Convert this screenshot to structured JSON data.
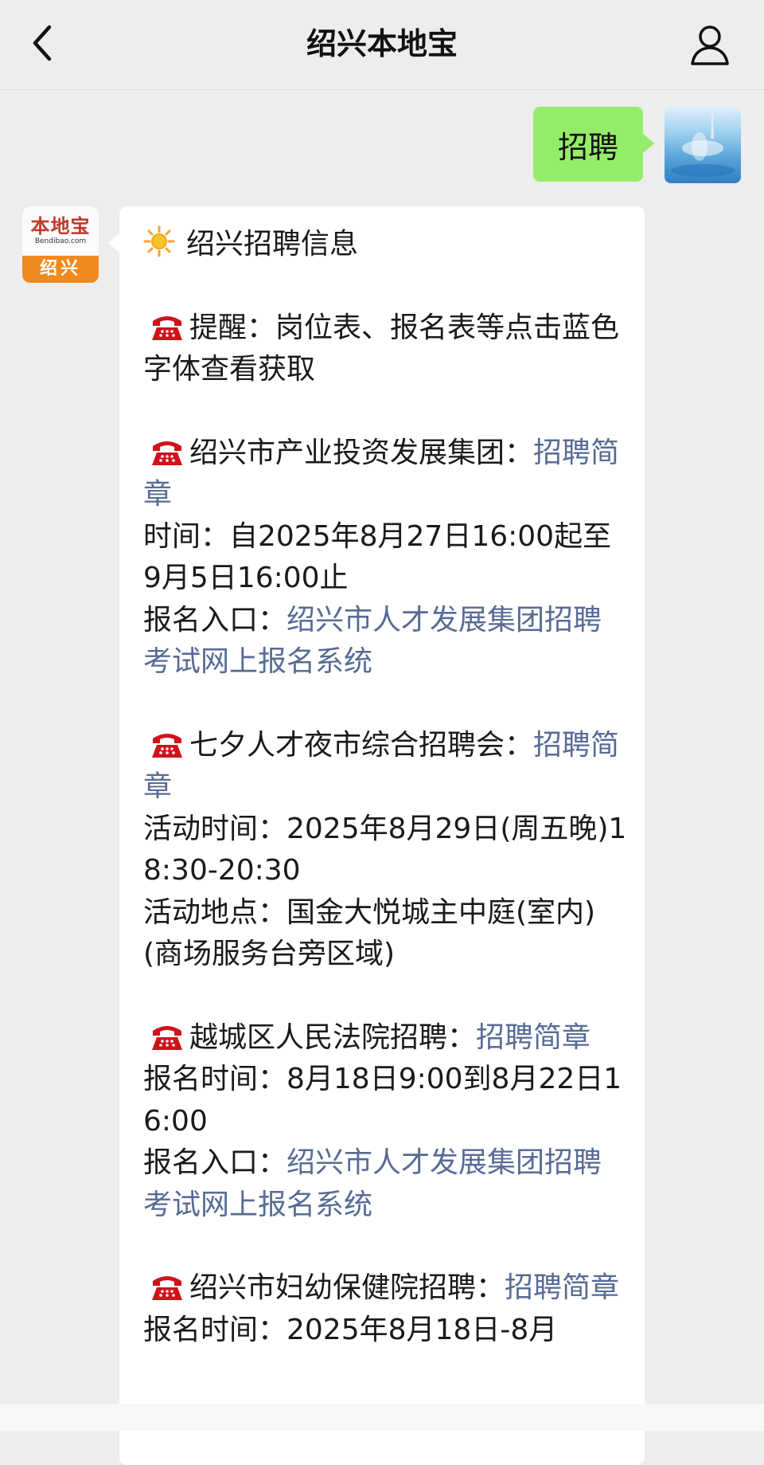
{
  "header": {
    "title": "绍兴本地宝",
    "back_icon": "chevron-left-icon",
    "profile_icon": "person-icon"
  },
  "user_message": {
    "text": "招聘",
    "bubble_color": "#95ec69"
  },
  "bot_avatar": {
    "logo_text": "本地宝",
    "logo_domain": "Bendibao.com",
    "city": "绍兴",
    "color": "#f08a1e"
  },
  "bot_message": {
    "title": "绍兴招聘信息",
    "link_color": "#576b95",
    "reminder": "提醒：岗位表、报名表等点击蓝色字体查看获取",
    "items": [
      {
        "name": "绍兴市产业投资发展集团：",
        "link": "招聘简章",
        "time": "时间：自2025年8月27日16:00起至9月5日16:00止",
        "entry_label": "报名入口：",
        "entry_link": "绍兴市人才发展集团招聘考试网上报名系统"
      },
      {
        "name": "七夕人才夜市综合招聘会：",
        "link": "招聘简章",
        "time": "活动时间：2025年8月29日(周五晚)18:30-20:30",
        "place": "活动地点：国金大悦城主中庭(室内)(商场服务台旁区域)"
      },
      {
        "name": "越城区人民法院招聘：",
        "link": "招聘简章",
        "time": "报名时间：8月18日9:00到8月22日16:00",
        "entry_label": "报名入口：",
        "entry_link": "绍兴市人才发展集团招聘考试网上报名系统"
      },
      {
        "name": "绍兴市妇幼保健院招聘：",
        "link": "招聘简章",
        "time": "报名时间：2025年8月18日-8月"
      }
    ]
  }
}
